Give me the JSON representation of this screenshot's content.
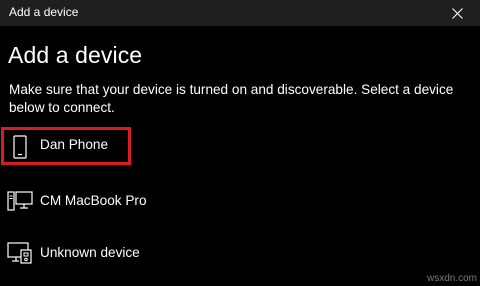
{
  "window": {
    "title": "Add a device"
  },
  "heading": "Add a device",
  "description": "Make sure that your device is turned on and discoverable. Select a device below to connect.",
  "devices": [
    {
      "name": "Dan Phone",
      "icon": "phone-icon",
      "highlighted": true
    },
    {
      "name": "CM MacBook Pro",
      "icon": "computer-icon",
      "highlighted": false
    },
    {
      "name": "Unknown device",
      "icon": "display-device-icon",
      "highlighted": false
    }
  ],
  "highlight_color": "#d81b25",
  "watermark": "wsxdn.com"
}
